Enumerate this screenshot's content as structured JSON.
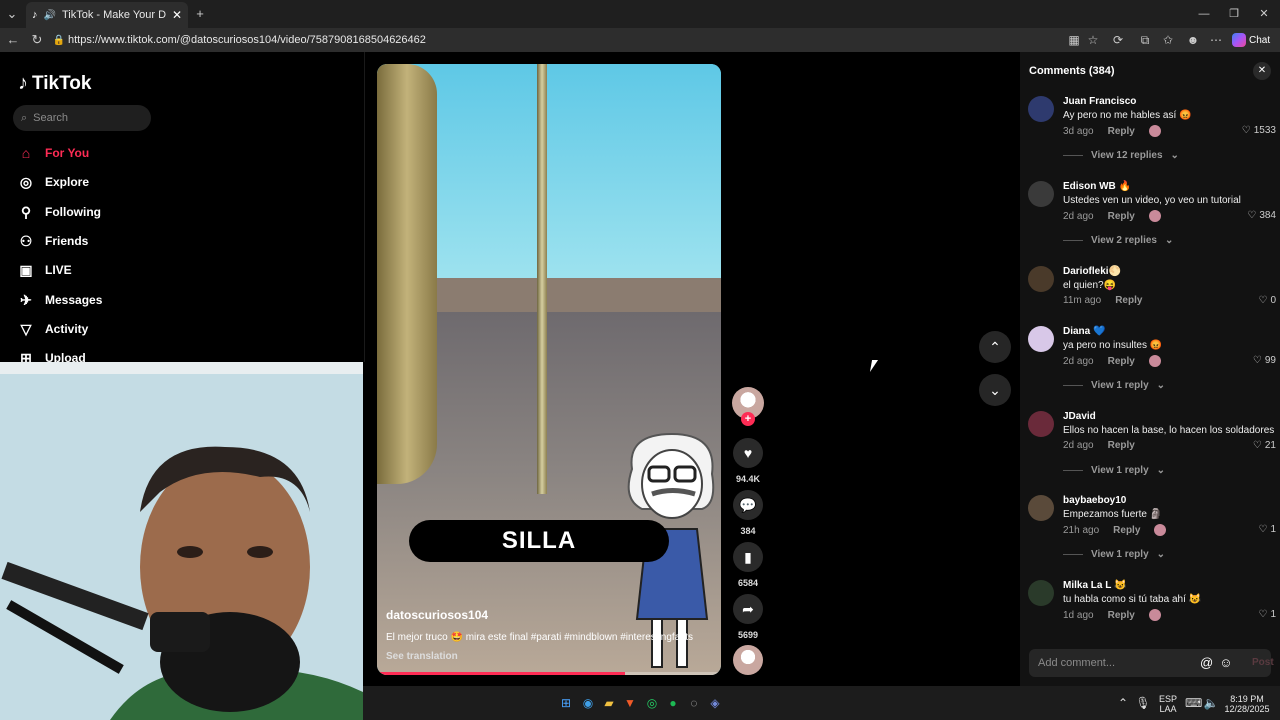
{
  "browser": {
    "tab_title": "TikTok - Make Your Day",
    "url": "https://www.tiktok.com/@datoscuriosos104/video/7587908168504626462",
    "chat_label": "Chat"
  },
  "sidebar": {
    "logo": "TikTok",
    "search_placeholder": "Search",
    "items": [
      {
        "label": "For You",
        "icon": "home-icon"
      },
      {
        "label": "Explore",
        "icon": "compass-icon"
      },
      {
        "label": "Following",
        "icon": "following-icon"
      },
      {
        "label": "Friends",
        "icon": "friends-icon"
      },
      {
        "label": "LIVE",
        "icon": "live-icon"
      },
      {
        "label": "Messages",
        "icon": "messages-icon"
      },
      {
        "label": "Activity",
        "icon": "activity-icon"
      },
      {
        "label": "Upload",
        "icon": "upload-icon"
      }
    ]
  },
  "video": {
    "overlay_text": "SILLA",
    "author": "datoscuriosos104",
    "description": "El mejor truco 🤩 mira este final #parati #mindblown #interestingfacts",
    "see_translation": "See translation",
    "progress": 0.72
  },
  "actions": {
    "likes": "94.4K",
    "comments": "384",
    "saves": "6584",
    "shares": "5699"
  },
  "comments": {
    "header": "Comments (384)",
    "add_placeholder": "Add comment...",
    "post_label": "Post",
    "items": [
      {
        "user": "Juan Francisco",
        "text": "Ay pero no me hables así 😡",
        "time": "3d ago",
        "reply": "Reply",
        "likes": "1533",
        "views": "View 12 replies",
        "color": "#2e3a6e"
      },
      {
        "user": "Edison WB 🔥",
        "text": "Ustedes ven un video, yo veo un tutorial",
        "time": "2d ago",
        "reply": "Reply",
        "likes": "384",
        "views": "View 2 replies",
        "color": "#3a3a3a"
      },
      {
        "user": "Dariofleki🌕",
        "text": "el quien?😝",
        "time": "11m ago",
        "reply": "Reply",
        "likes": "0",
        "views": "",
        "color": "#4a3a2a"
      },
      {
        "user": "Diana 💙",
        "text": "ya pero no insultes 😡",
        "time": "2d ago",
        "reply": "Reply",
        "likes": "99",
        "views": "View 1 reply",
        "color": "#d8c8e8"
      },
      {
        "user": "JDavid",
        "text": "Ellos no hacen la base, lo hacen los soldadores",
        "time": "2d ago",
        "reply": "Reply",
        "likes": "21",
        "views": "View 1 reply",
        "color": "#6a2a3a"
      },
      {
        "user": "baybaeboy10",
        "text": "Empezamos fuerte 🗿",
        "time": "21h ago",
        "reply": "Reply",
        "likes": "1",
        "views": "View 1 reply",
        "color": "#5a4a3a"
      },
      {
        "user": "Milka La L 😺",
        "text": "tu habla como si tú taba ahí 😺",
        "time": "1d ago",
        "reply": "Reply",
        "likes": "1",
        "views": "",
        "color": "#2a3a2a"
      }
    ]
  },
  "taskbar": {
    "lang": "ESP",
    "lang2": "LAA",
    "time": "8:19 PM",
    "date": "12/28/2025"
  }
}
